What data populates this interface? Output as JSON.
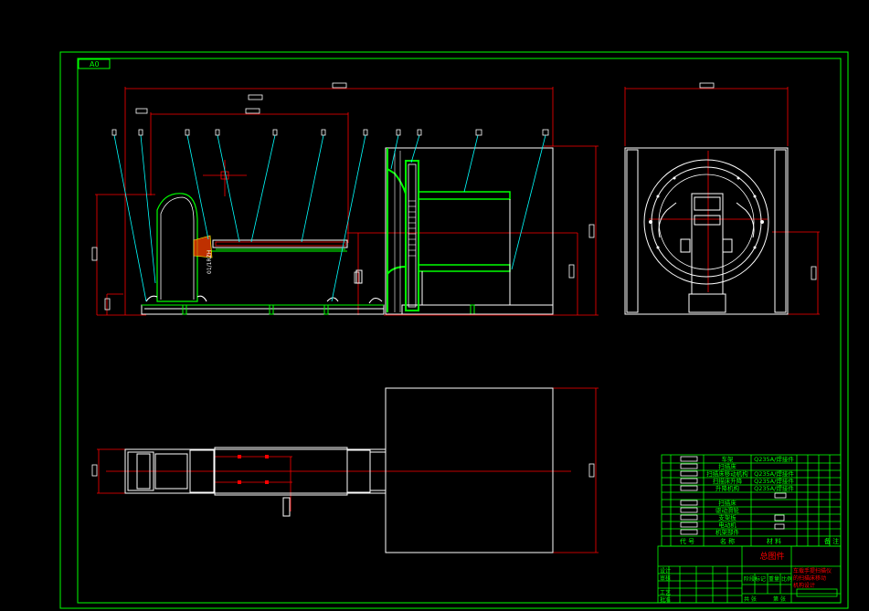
{
  "drawing": {
    "sheet_no": "A0",
    "colors": {
      "frame": "#00ff00",
      "outline": "#ffffff",
      "dimension": "#ff0000",
      "leader": "#00ffff",
      "hatch": "#ff4000",
      "tag": "#ffffff"
    },
    "center_label": "01/1RZH"
  },
  "bom": {
    "rows": [
      {
        "name": "车架",
        "material": "Q235A/焊接件"
      },
      {
        "name": "扫描床",
        "material": ""
      },
      {
        "name": "扫描床移动机构",
        "material": "Q235A/焊接件"
      },
      {
        "name": "扫描床升降",
        "material": "Q235A/焊接件"
      },
      {
        "name": "升降机构",
        "material": "Q235A/焊接件"
      },
      {
        "name": "",
        "material": ""
      },
      {
        "name": "扫描床",
        "material": ""
      },
      {
        "name": "驱动滑轮",
        "material": ""
      },
      {
        "name": "支架板",
        "material": ""
      },
      {
        "name": "电动机",
        "material": ""
      },
      {
        "name": "机架部件",
        "material": ""
      }
    ],
    "header": {
      "code": "代 号",
      "name": "名 称",
      "material": "材 料",
      "note": "备 注",
      "extra": "单件总计"
    }
  },
  "title_block": {
    "drawing_title": "总图件",
    "project_lines": [
      "车载手提扫描仪",
      "的扫描床移动",
      "机构设计"
    ],
    "label_scale": "比例",
    "label_weight": "重量",
    "label_sheet": "共  张",
    "label_sheet_of": "第  张",
    "label_stage": "阶段标记",
    "label_design": "设计",
    "label_check": "审核",
    "label_process": "工艺",
    "label_approve": "批准"
  }
}
